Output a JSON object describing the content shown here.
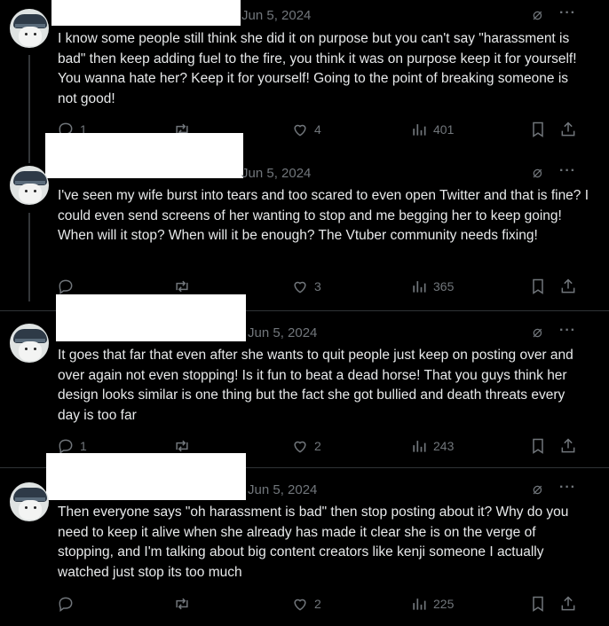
{
  "posts": [
    {
      "date": "Jun 5, 2024",
      "text": "I know some people still think she did it on purpose but you can't say \"harassment is bad\" then keep adding fuel to the fire, you think it was on purpose keep it for yourself! You wanna hate her? Keep it for yourself! Going to the point of breaking someone is not good!",
      "replies": "1",
      "reposts": "",
      "likes": "4",
      "views": "401"
    },
    {
      "date": "Jun 5, 2024",
      "text": "I've seen my wife burst into tears and too scared to even open Twitter and that is fine? I could even send screens of her wanting to stop and me begging her to keep going! When will it stop? When will it be enough? The Vtuber community needs fixing!",
      "replies": "",
      "reposts": "",
      "likes": "3",
      "views": "365"
    },
    {
      "date": "Jun 5, 2024",
      "text": "It goes that far that even after she wants to quit people just keep on posting over and over again not even stopping! Is it fun to beat a dead horse! That you guys think her design looks similar is one thing but the fact she got bullied and death threats every day is too far",
      "replies": "1",
      "reposts": "",
      "likes": "2",
      "views": "243"
    },
    {
      "date": "Jun 5, 2024",
      "text": "Then everyone says \"oh harassment is bad\" then stop posting about it? Why do you need to keep it alive when she already has made it clear she is on the verge of stopping, and I'm talking about big content creators  like kenji someone I actually watched just stop its too much",
      "replies": "",
      "reposts": "",
      "likes": "2",
      "views": "225"
    }
  ],
  "colors": {
    "background": "#000000",
    "text": "#e7e9ea",
    "muted": "#71767b",
    "divider": "#2f3336"
  },
  "icons": [
    "grok-icon",
    "more-icon",
    "reply-icon",
    "repost-icon",
    "like-icon",
    "views-icon",
    "bookmark-icon",
    "share-icon"
  ]
}
